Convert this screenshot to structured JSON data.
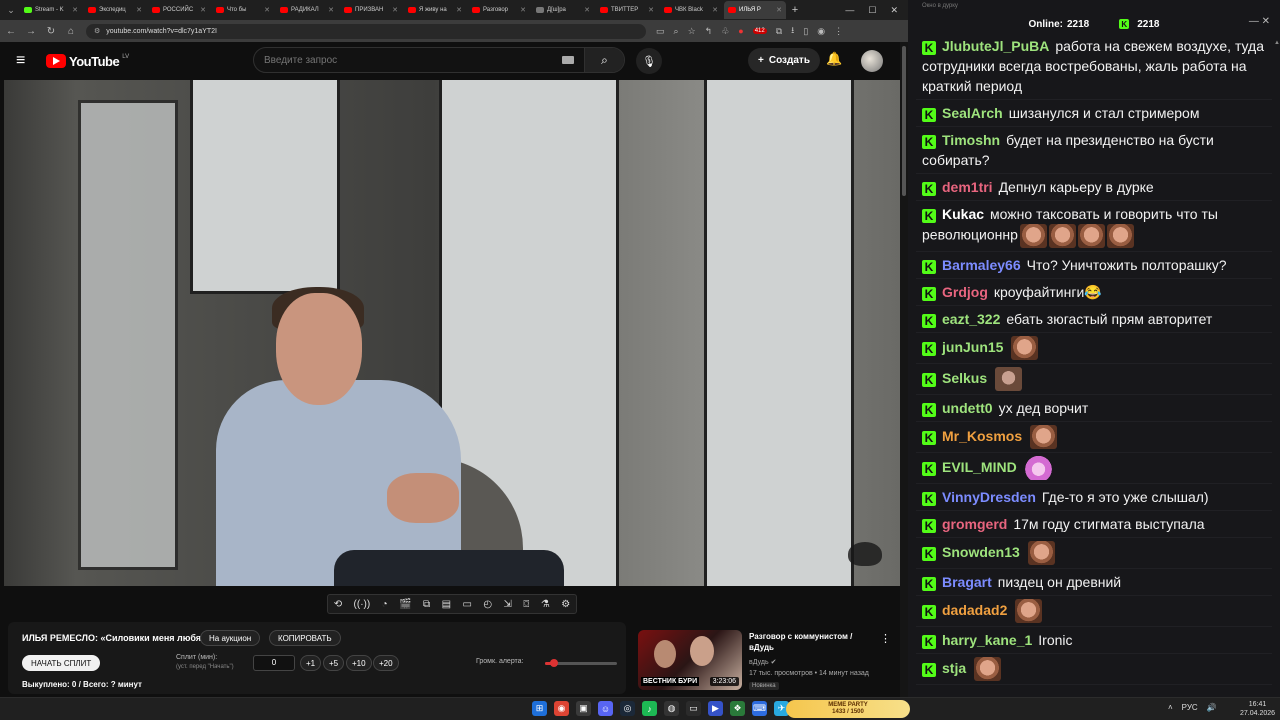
{
  "browser": {
    "tabs": [
      {
        "label": "Stream - K",
        "color": "#53fc18"
      },
      {
        "label": "Экспедиц",
        "color": "#ff0000"
      },
      {
        "label": "РОССИЙС",
        "color": "#ff0000"
      },
      {
        "label": "Что бы",
        "color": "#ff0000"
      },
      {
        "label": "РАДИКАЛ",
        "color": "#ff0000"
      },
      {
        "label": "ПРИЗВАН",
        "color": "#ff0000"
      },
      {
        "label": "Я живу на",
        "color": "#ff0000"
      },
      {
        "label": "Разговор",
        "color": "#ff0000"
      },
      {
        "label": "Д[ш]ра",
        "color": "#777777"
      },
      {
        "label": "ТВИТТЕР",
        "color": "#ff0000"
      },
      {
        "label": "ЧВК Black",
        "color": "#ff0000"
      },
      {
        "label": "ИЛЬЯ Р",
        "color": "#ff0000"
      }
    ],
    "url": "youtube.com/watch?v=dlc7y1aYT2I",
    "ext_badge": "412"
  },
  "youtube": {
    "logo_text": "YouTube",
    "country": "LV",
    "search_placeholder": "Введите запрос",
    "create_label": "Создать"
  },
  "panel": {
    "title": "ИЛЬЯ РЕМЕСЛО: «Силовики меня любят»",
    "auction_btn": "На аукцион",
    "copy_btn": "КОПИРОВАТЬ",
    "start_split_btn": "НАЧАТЬ СПЛИТ",
    "split_label": "Сплит (мин):",
    "split_sub": "(уст. перед \"Начать\")",
    "split_value": "0",
    "steps": [
      "+1",
      "+5",
      "+10",
      "+20"
    ],
    "volume_label": "Громк. алерта:",
    "volume_level": 0.13,
    "stats": "Выкуплено: 0 / Всего: ? минут"
  },
  "recommendation": {
    "title": "Разговор с коммунистом / вДудь",
    "channel": "вДудь",
    "meta": "17 тыс. просмотров • 14 минут назад",
    "badge": "Новинка",
    "thumb_text": "ВЕСТНИК БУРИ",
    "duration": "3:23:06"
  },
  "chat": {
    "window_title": "Окно в дурку",
    "online_label": "Online:",
    "online_count": "2218",
    "viewers": "2218",
    "messages": [
      {
        "user": "JlubuteJl_PuBA",
        "color": "#9ee37d",
        "text": "работа на свежем воздухе, туда сотрудники всегда востребованы, жаль работа на краткий период",
        "emotes": []
      },
      {
        "user": "SealArch",
        "color": "#9ee37d",
        "text": "шизанулся и стал стримером",
        "emotes": []
      },
      {
        "user": "Timoshn",
        "color": "#9ee37d",
        "text": "будет на президенство на бусти собирать?",
        "emotes": []
      },
      {
        "user": "dem1tri",
        "color": "#e8657f",
        "text": "Депнул карьеру в дурке",
        "emotes": []
      },
      {
        "user": "Kukac",
        "color": "#ffffff",
        "text": "можно таксовать и говорить что ты революционнр",
        "emotes": [
          "face",
          "face",
          "face",
          "face"
        ]
      },
      {
        "user": "Barmaley66",
        "color": "#7c8cff",
        "text": "Что? Уничтожить полторашку?",
        "emotes": []
      },
      {
        "user": "Grdjog",
        "color": "#e8657f",
        "text": "кроуфайтинги😂",
        "emotes": []
      },
      {
        "user": "eazt_322",
        "color": "#9ee37d",
        "text": "ебать зюгастый прям авторитет",
        "emotes": []
      },
      {
        "user": "junJun15",
        "color": "#9ee37d",
        "text": "",
        "emotes": [
          "face"
        ]
      },
      {
        "user": "Selkus",
        "color": "#9ee37d",
        "text": "",
        "emotes": [
          "dark"
        ]
      },
      {
        "user": "undett0",
        "color": "#9ee37d",
        "text": "ух дед ворчит",
        "emotes": []
      },
      {
        "user": "Mr_Kosmos",
        "color": "#f0a040",
        "text": "",
        "emotes": [
          "face"
        ]
      },
      {
        "user": "EVIL_MIND",
        "color": "#9ee37d",
        "text": "",
        "emotes": [
          "pink"
        ]
      },
      {
        "user": "VinnyDresden",
        "color": "#7c8cff",
        "text": "Где-то я это уже слышал)",
        "emotes": []
      },
      {
        "user": "gromgerd",
        "color": "#e8657f",
        "text": "17м году стигмата выступала",
        "emotes": []
      },
      {
        "user": "Snowden13",
        "color": "#9ee37d",
        "text": "",
        "emotes": [
          "face"
        ]
      },
      {
        "user": "Bragart",
        "color": "#7c8cff",
        "text": "пиздец он древний",
        "emotes": []
      },
      {
        "user": "dadadad2",
        "color": "#f0a040",
        "text": "",
        "emotes": [
          "face"
        ]
      },
      {
        "user": "harry_kane_1",
        "color": "#9ee37d",
        "text": "Ironic",
        "emotes": []
      },
      {
        "user": "stja",
        "color": "#9ee37d",
        "text": "",
        "emotes": [
          "face"
        ]
      }
    ]
  },
  "taskbar": {
    "meme_title": "MEME PARTY",
    "meme_progress": "1433 / 1500",
    "lang": "РУС",
    "time": "16:41",
    "date": "27.04.2026"
  }
}
